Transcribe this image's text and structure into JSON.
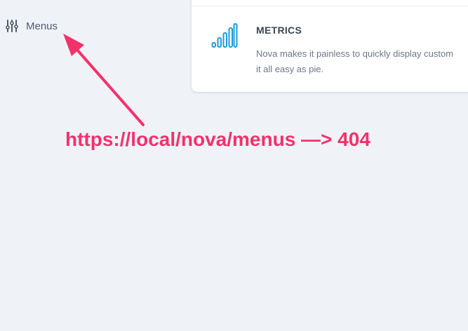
{
  "sidebar": {
    "menus_label": "Menus",
    "menus_icon": "sliders-icon"
  },
  "card": {
    "icon": "signal-bars-icon",
    "title": "METRICS",
    "description_line1": "Nova makes it painless to quickly display custom",
    "description_line2": "it all easy as pie."
  },
  "annotation": {
    "text": "https://local/nova/menus —> 404",
    "color": "#f4316a"
  },
  "colors": {
    "background": "#eff3f8",
    "accent": "#1a9cd9"
  }
}
